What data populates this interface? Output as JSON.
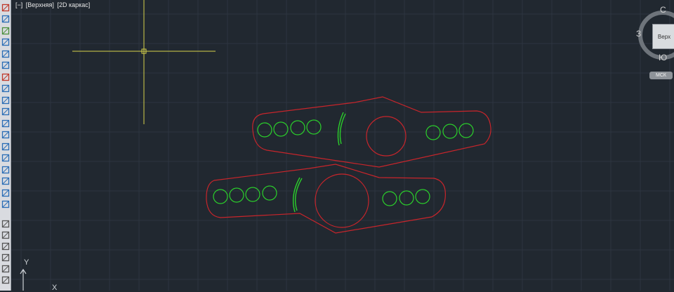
{
  "viewport": {
    "controls": "[−]",
    "view": "[Верхняя]",
    "visual_style": "[2D каркас]"
  },
  "viewcube": {
    "north": "С",
    "south": "Ю",
    "west": "З",
    "face": "Верх"
  },
  "ucs": {
    "label": "МСК"
  },
  "axes": {
    "y": "Y",
    "x": "X"
  },
  "toolbar_icons": [
    "line-icon",
    "polyline-icon",
    "mirror-icon",
    "offset-icon",
    "array-icon",
    "move-icon",
    "rotate-icon",
    "scale-icon",
    "stretch-icon",
    "trim-icon",
    "extend-icon",
    "break-icon",
    "join-icon",
    "chamfer-icon",
    "fillet-icon",
    "blend-icon",
    "explode-icon",
    "copy-icon",
    "layer-icon",
    "layer-prev-icon",
    "layer-iso-icon",
    "layer-freeze-icon",
    "layer-off-icon",
    "layer-lock-icon"
  ],
  "colors": {
    "background": "#212830",
    "grid": "#2d3540",
    "crosshair": "#d6d24a",
    "outline": "#c8252b",
    "holes": "#2bd02b"
  }
}
